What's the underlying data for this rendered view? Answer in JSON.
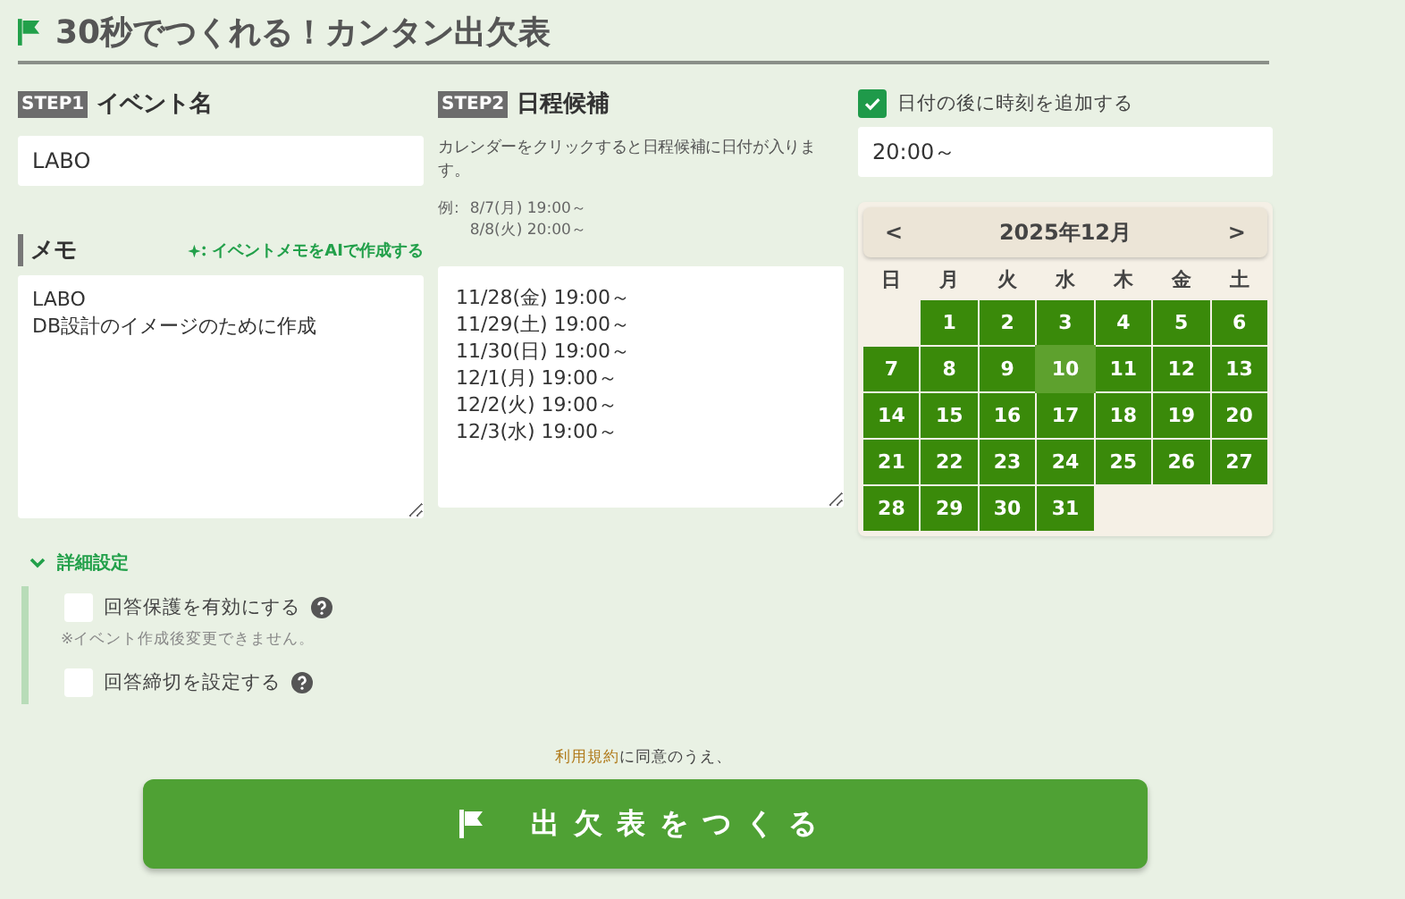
{
  "header": {
    "title": "30秒でつくれる！カンタン出欠表"
  },
  "event_name": {
    "step": "STEP1",
    "label": "イベント名",
    "value": "LABO"
  },
  "memo": {
    "label": "メモ",
    "ai_link": "イベントメモをAIで作成する",
    "value": "LABO\nDB設計のイメージのために作成"
  },
  "schedule": {
    "step": "STEP2",
    "label": "日程候補",
    "description": "カレンダーをクリックすると日程候補に日付が入ります。",
    "example_label": "例:",
    "examples": [
      "8/7(月) 19:00～",
      "8/8(火) 20:00～"
    ],
    "value": "11/28(金) 19:00～\n11/29(土) 19:00～\n11/30(日) 19:00～\n12/1(月) 19:00～\n12/2(火) 19:00～\n12/3(水) 19:00～"
  },
  "time_option": {
    "label": "日付の後に時刻を追加する",
    "checked": true,
    "value": "20:00～"
  },
  "calendar": {
    "prev": "<",
    "month": "2025年12月",
    "next": ">",
    "weekdays": [
      "日",
      "月",
      "火",
      "水",
      "木",
      "金",
      "土"
    ],
    "days": [
      {
        "kind": "blank"
      },
      {
        "kind": "day",
        "label": "1",
        "selected": true,
        "hovered": false
      },
      {
        "kind": "day",
        "label": "2",
        "selected": true,
        "hovered": false
      },
      {
        "kind": "day",
        "label": "3",
        "selected": true,
        "hovered": false
      },
      {
        "kind": "day",
        "label": "4",
        "selected": true,
        "hovered": false
      },
      {
        "kind": "day",
        "label": "5",
        "selected": true,
        "hovered": false
      },
      {
        "kind": "day",
        "label": "6",
        "selected": true,
        "hovered": false
      },
      {
        "kind": "day",
        "label": "7",
        "selected": true,
        "hovered": false
      },
      {
        "kind": "day",
        "label": "8",
        "selected": true,
        "hovered": false
      },
      {
        "kind": "day",
        "label": "9",
        "selected": true,
        "hovered": false
      },
      {
        "kind": "day",
        "label": "10",
        "selected": true,
        "hovered": true
      },
      {
        "kind": "day",
        "label": "11",
        "selected": true,
        "hovered": false
      },
      {
        "kind": "day",
        "label": "12",
        "selected": true,
        "hovered": false
      },
      {
        "kind": "day",
        "label": "13",
        "selected": true,
        "hovered": false
      },
      {
        "kind": "day",
        "label": "14",
        "selected": true,
        "hovered": false
      },
      {
        "kind": "day",
        "label": "15",
        "selected": true,
        "hovered": false
      },
      {
        "kind": "day",
        "label": "16",
        "selected": true,
        "hovered": false
      },
      {
        "kind": "day",
        "label": "17",
        "selected": true,
        "hovered": false
      },
      {
        "kind": "day",
        "label": "18",
        "selected": true,
        "hovered": false
      },
      {
        "kind": "day",
        "label": "19",
        "selected": true,
        "hovered": false
      },
      {
        "kind": "day",
        "label": "20",
        "selected": true,
        "hovered": false
      },
      {
        "kind": "day",
        "label": "21",
        "selected": true,
        "hovered": false
      },
      {
        "kind": "day",
        "label": "22",
        "selected": true,
        "hovered": false
      },
      {
        "kind": "day",
        "label": "23",
        "selected": true,
        "hovered": false
      },
      {
        "kind": "day",
        "label": "24",
        "selected": true,
        "hovered": false
      },
      {
        "kind": "day",
        "label": "25",
        "selected": true,
        "hovered": false
      },
      {
        "kind": "day",
        "label": "26",
        "selected": true,
        "hovered": false
      },
      {
        "kind": "day",
        "label": "27",
        "selected": true,
        "hovered": false
      },
      {
        "kind": "day",
        "label": "28",
        "selected": true,
        "hovered": false
      },
      {
        "kind": "day",
        "label": "29",
        "selected": true,
        "hovered": false
      },
      {
        "kind": "day",
        "label": "30",
        "selected": true,
        "hovered": false
      },
      {
        "kind": "day",
        "label": "31",
        "selected": true,
        "hovered": false
      }
    ]
  },
  "details": {
    "label": "詳細設定",
    "expanded": true,
    "options": [
      {
        "label": "回答保護を有効にする",
        "checked": false,
        "note": "※イベント作成後変更できません。"
      },
      {
        "label": "回答締切を設定する",
        "checked": false
      }
    ]
  },
  "terms": {
    "link": "利用規約",
    "text": "に同意のうえ、"
  },
  "submit": {
    "label": "出欠表をつくる"
  }
}
